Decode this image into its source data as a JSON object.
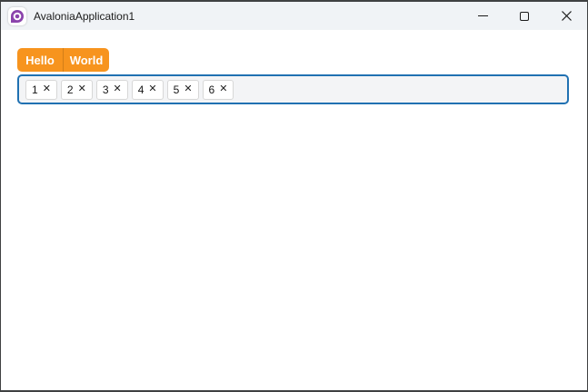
{
  "window": {
    "title": "AvaloniaApplication1"
  },
  "titlebar": {
    "icons": {
      "app_logo": "avalonia-logo",
      "minimize": "horizontal-line",
      "maximize": "square-outline",
      "close": "x-cross"
    }
  },
  "tabs": {
    "items": [
      {
        "label": "Hello"
      },
      {
        "label": "World"
      }
    ]
  },
  "chips": {
    "items": [
      "1",
      "2",
      "3",
      "4",
      "5",
      "6"
    ],
    "remove_glyph": "✕"
  },
  "colors": {
    "accent_orange": "#f7941e",
    "focus_border_blue": "#2071b2",
    "logo_purple": "#8b44ac",
    "titlebar_bg": "#f0f3f6",
    "window_border": "#3f4142",
    "chip_bg": "#ffffff",
    "chip_border": "#d7d7d7",
    "chips_box_bg": "#f3f4f6"
  }
}
